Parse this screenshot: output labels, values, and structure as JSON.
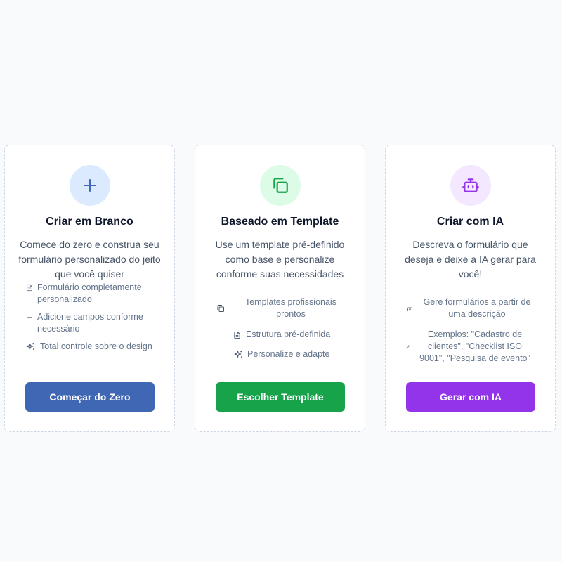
{
  "colors": {
    "blank_accent": "#4067b3",
    "template_accent": "#17a34a",
    "ai_accent": "#9333ea"
  },
  "cards": [
    {
      "icon": "plus-icon",
      "title": "Criar em Branco",
      "description": "Comece do zero e construa seu formulário personalizado do jeito que você quiser",
      "features": [
        {
          "icon": "file-text-icon",
          "text": "Formulário completamente personalizado"
        },
        {
          "icon": "plus-icon",
          "text": "Adicione campos conforme necessário"
        },
        {
          "icon": "sparkles-icon",
          "text": "Total controle sobre o design"
        }
      ],
      "button": "Começar do Zero"
    },
    {
      "icon": "copy-icon",
      "title": "Baseado em Template",
      "description": "Use um template pré-definido como base e personalize conforme suas necessidades",
      "features": [
        {
          "icon": "copy-icon",
          "text": "Templates profissionais prontos"
        },
        {
          "icon": "file-text-icon",
          "text": "Estrutura pré-definida"
        },
        {
          "icon": "sparkles-icon",
          "text": "Personalize e adapte"
        }
      ],
      "button": "Escolher Template"
    },
    {
      "icon": "bot-icon",
      "title": "Criar com IA",
      "description": "Descreva o formulário que deseja e deixe a IA gerar para você!",
      "features": [
        {
          "icon": "bot-icon",
          "text": "Gere formulários a partir de uma descrição"
        },
        {
          "icon": "wand-icon",
          "text": "Exemplos: \"Cadastro de clientes\", \"Checklist ISO 9001\", \"Pesquisa de evento\""
        }
      ],
      "button": "Gerar com IA"
    }
  ]
}
